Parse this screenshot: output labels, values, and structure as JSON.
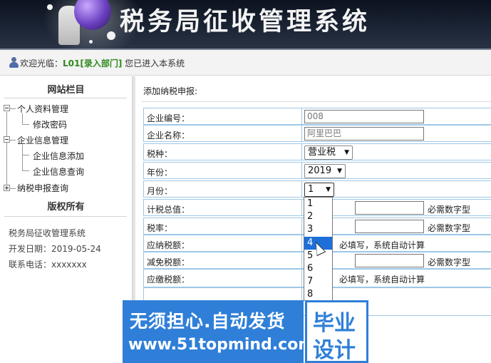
{
  "header": {
    "title": "税务局征收管理系统"
  },
  "welcome": {
    "prefix": "欢迎光临：",
    "user": "L01[录入部门]",
    "suffix": " 您已进入本系统"
  },
  "sidebar": {
    "heading": "网站栏目",
    "items": [
      {
        "label": "个人资料管理"
      },
      {
        "label": "修改密码"
      },
      {
        "label": "企业信息管理"
      },
      {
        "label": "企业信息添加"
      },
      {
        "label": "企业信息查询"
      },
      {
        "label": "纳税申报查询"
      }
    ],
    "copyright": "版权所有",
    "info": [
      "税务局征收管理系统",
      "开发日期：2019-05-24",
      "联系电话：xxxxxxx"
    ]
  },
  "main": {
    "title": "添加纳税申报:",
    "rows": [
      {
        "label": "企业编号：",
        "value": "008"
      },
      {
        "label": "企业名称：",
        "value": "阿里巴巴"
      },
      {
        "label": "税种：",
        "value": "营业税"
      },
      {
        "label": "年份：",
        "value": "2019"
      },
      {
        "label": "月份：",
        "value": "1"
      },
      {
        "label": "计税总值：",
        "hint": "必需数字型"
      },
      {
        "label": "税率：",
        "hint": "必需数字型"
      },
      {
        "label": "应纳税额：",
        "hint": "必填写，系统自动计算"
      },
      {
        "label": "减免税额：",
        "hint": "必需数字型"
      },
      {
        "label": "应缴税额：",
        "hint": "必填写，系统自动计算"
      }
    ],
    "month_options": [
      "1",
      "2",
      "3",
      "4",
      "5",
      "6",
      "7",
      "8"
    ],
    "month_highlighted": "4"
  },
  "watermark": {
    "line1": "无须担心.自动发货",
    "line2": "www.51topmind.com",
    "badge1": "毕业",
    "badge2": "设计"
  },
  "colors": {
    "header_bg": "#1b2434",
    "table_border": "#9ec7e6",
    "selected": "#1e6fd9",
    "watermark": "#2f7fd8",
    "accent_green": "#2f8a1f"
  }
}
